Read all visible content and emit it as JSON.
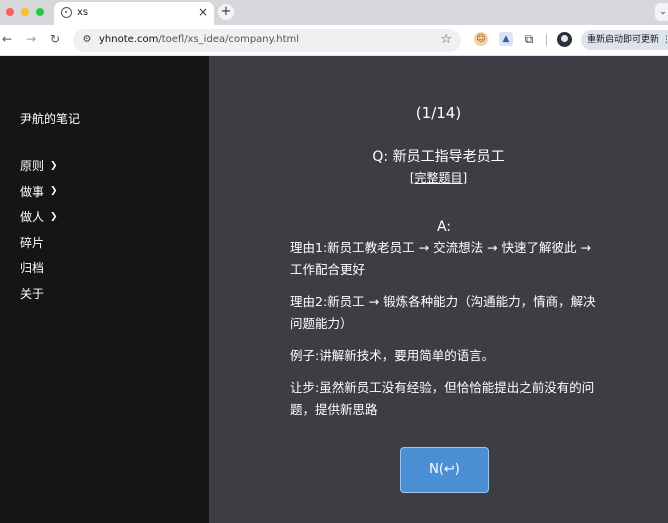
{
  "browser": {
    "tab": {
      "title": "xs",
      "close_glyph": "×"
    },
    "new_tab_glyph": "+",
    "more_glyph": "⌄",
    "url_host": "yhnote.com",
    "url_path": "/toefl/xs_idea/company.html",
    "update_label": "重新启动即可更新  ⋮",
    "icons": [
      "back-icon",
      "forward-icon",
      "reload-icon",
      "site-info-icon",
      "star-icon",
      "extension-icon",
      "profile-icon"
    ]
  },
  "sidebar": {
    "brand": "尹航的笔记",
    "items": [
      {
        "label": "原则",
        "chevron": "❯"
      },
      {
        "label": "做事",
        "chevron": "❯"
      },
      {
        "label": "做人",
        "chevron": "❯"
      },
      {
        "label": "碎片",
        "chevron": ""
      },
      {
        "label": "归档",
        "chevron": ""
      },
      {
        "label": "关于",
        "chevron": ""
      }
    ]
  },
  "main": {
    "counter": "(1/14)",
    "question": "Q: 新员工指导老员工",
    "full_link": "[完整题目]",
    "answer_label": "A:",
    "answers": [
      "理由1:新员工教老员工 → 交流想法 → 快速了解彼此 → 工作配合更好",
      "理由2:新员工 → 锻炼各种能力（沟通能力，情商，解决问题能力）",
      "例子:讲解新技术，要用简单的语言。",
      "让步:虽然新员工没有经验，但恰恰能提出之前没有的问题，提供新思路"
    ],
    "next_button": "N(↩)"
  },
  "colors": {
    "sidebar_bg": "#151515",
    "main_bg": "#3d3d44",
    "button_bg": "#4a8ed4"
  }
}
